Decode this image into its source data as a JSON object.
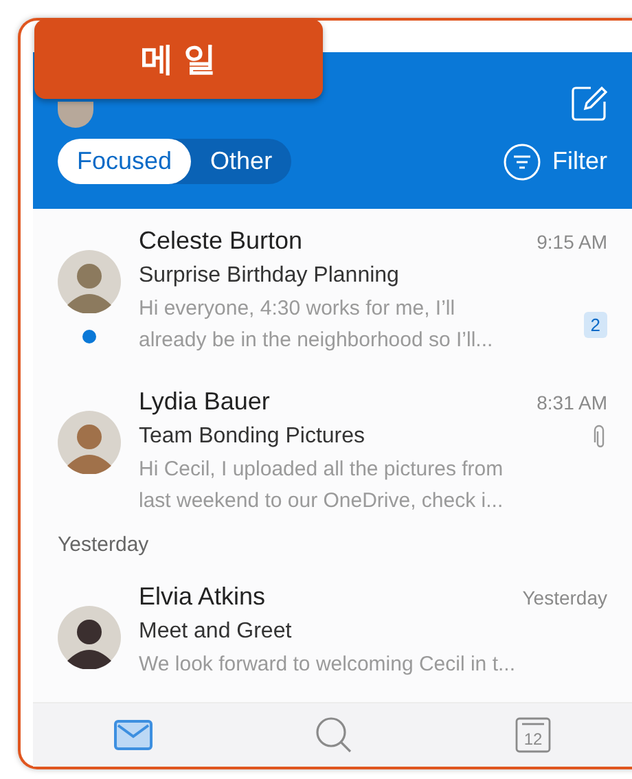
{
  "badge": {
    "label": "메 일"
  },
  "header": {
    "tabs": [
      {
        "label": "Focused",
        "selected": true
      },
      {
        "label": "Other",
        "selected": false
      }
    ],
    "filter": {
      "label": "Filter"
    }
  },
  "list": [
    {
      "kind": "message",
      "sender": "Celeste Burton",
      "time": "9:15 AM",
      "subject": "Surprise Birthday Planning",
      "preview_lines": [
        "Hi everyone, 4:30 works for me, I’ll",
        "already be in the neighborhood so I’ll..."
      ],
      "unread": true,
      "count": "2",
      "attachment": false
    },
    {
      "kind": "message",
      "sender": "Lydia Bauer",
      "time": "8:31 AM",
      "subject": "Team Bonding Pictures",
      "preview_lines": [
        "Hi Cecil, I uploaded all the pictures from",
        "last weekend to our OneDrive, check i..."
      ],
      "unread": false,
      "attachment": true
    },
    {
      "kind": "section",
      "label": "Yesterday"
    },
    {
      "kind": "message",
      "sender": "Elvia Atkins",
      "time": "Yesterday",
      "subject": "Meet and Greet",
      "preview_lines": [
        "We look forward to welcoming Cecil in t..."
      ],
      "unread": false,
      "attachment": false
    }
  ],
  "tab_bar": [
    {
      "kind": "mail",
      "selected": true
    },
    {
      "kind": "search",
      "selected": false
    },
    {
      "kind": "calendar",
      "selected": false,
      "label": "12"
    }
  ]
}
